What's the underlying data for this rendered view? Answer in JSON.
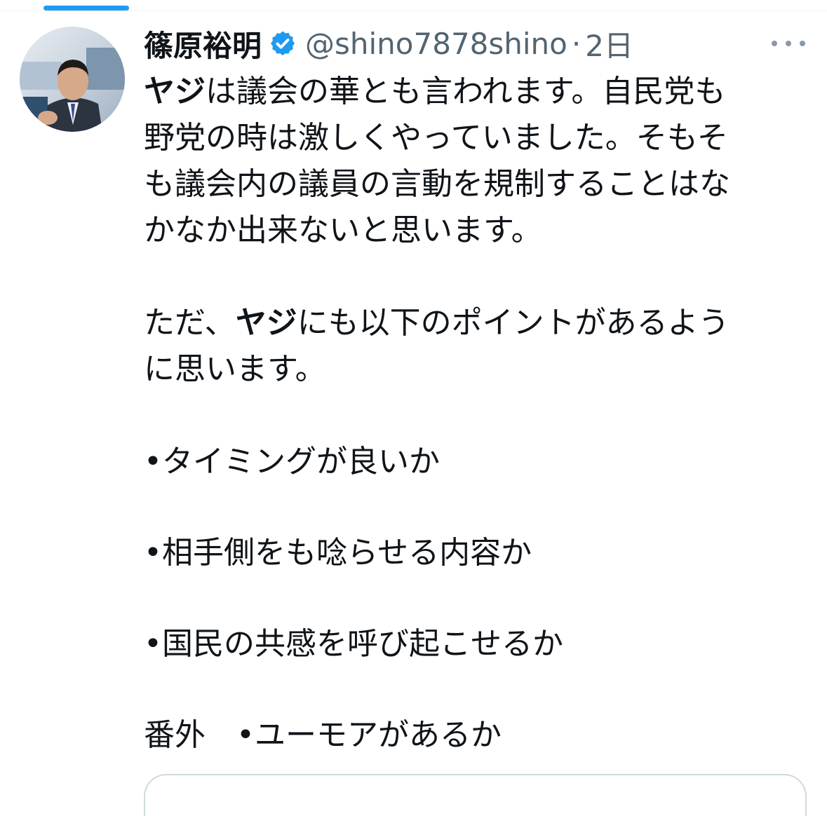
{
  "tweet": {
    "author": {
      "display_name": "篠原裕明",
      "handle": "@shino7878shino",
      "verified": true,
      "avatar_icon": "avatar-photo"
    },
    "separator": "·",
    "timestamp": "2日",
    "more_icon": "more-horizontal-icon",
    "body": {
      "p1_bold": "ヤジ",
      "p1_lines": [
        "は議会の華とも言われます。自民党も",
        "野党の時は激しくやっていました。そもそ",
        "も議会内の議員の言動を規制することはな",
        "かなか出来ないと思います。"
      ],
      "p2_prefix": "ただ、",
      "p2_bold": "ヤジ",
      "p2_line1": "にも以下のポイントがあるよう",
      "p2_line2": "に思います。",
      "bullet1": "•タイミングが良いか",
      "bullet2": "•相手側をも唸らせる内容か",
      "bullet3": "•国民の共感を呼び起こせるか",
      "extra": "番外　•ユーモアがあるか"
    }
  },
  "colors": {
    "accent": "#1d9bf0",
    "text_primary": "#0f1419",
    "text_secondary": "#536471"
  }
}
